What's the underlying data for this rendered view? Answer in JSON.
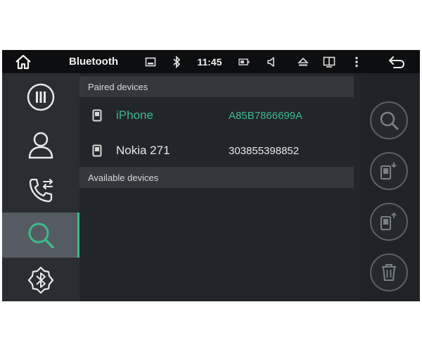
{
  "statusbar": {
    "title": "Bluetooth",
    "time": "11:45"
  },
  "sidebar": {
    "items": [
      {
        "name": "dialpad",
        "icon": "dialpad-icon"
      },
      {
        "name": "contacts",
        "icon": "contact-icon"
      },
      {
        "name": "call-log",
        "icon": "call-log-icon"
      },
      {
        "name": "search",
        "icon": "search-icon",
        "active": true
      },
      {
        "name": "bluetooth-settings",
        "icon": "bluetooth-icon"
      }
    ]
  },
  "main": {
    "paired_header": "Paired devices",
    "available_header": "Available devices",
    "paired_devices": [
      {
        "name": "iPhone",
        "address": "A85B7866699A",
        "connected": true
      },
      {
        "name": "Nokia 271",
        "address": "303855398852",
        "connected": false
      }
    ]
  },
  "actions": [
    {
      "name": "search",
      "icon": "search-icon"
    },
    {
      "name": "connect",
      "icon": "phone-connect-icon"
    },
    {
      "name": "disconnect",
      "icon": "phone-disconnect-icon"
    },
    {
      "name": "delete",
      "icon": "trash-icon"
    }
  ],
  "colors": {
    "accent": "#3fb98a",
    "background": "#1b1e23",
    "statusbar": "#0d0e10"
  }
}
